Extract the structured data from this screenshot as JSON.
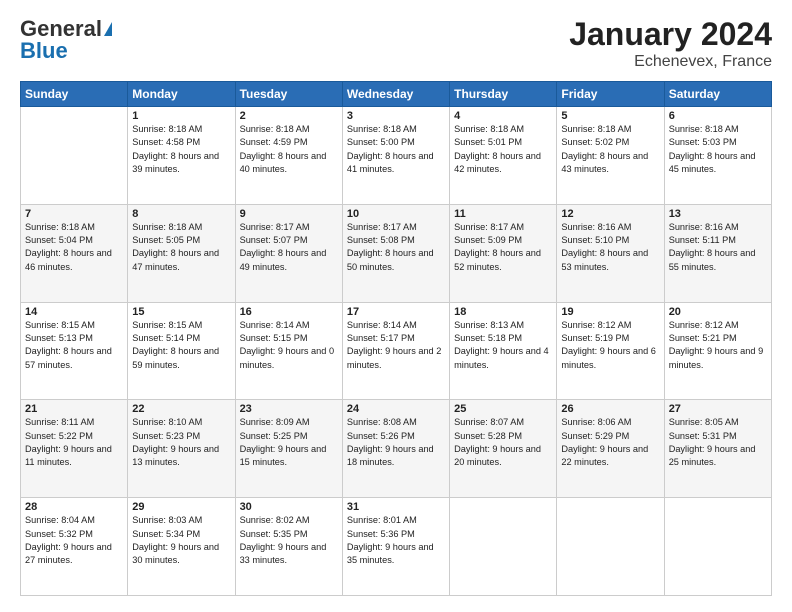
{
  "header": {
    "logo_line1": "General",
    "logo_line2": "Blue",
    "title": "January 2024",
    "subtitle": "Echenevex, France"
  },
  "weekdays": [
    "Sunday",
    "Monday",
    "Tuesday",
    "Wednesday",
    "Thursday",
    "Friday",
    "Saturday"
  ],
  "weeks": [
    [
      {
        "day": "",
        "sunrise": "",
        "sunset": "",
        "daylight": ""
      },
      {
        "day": "1",
        "sunrise": "Sunrise: 8:18 AM",
        "sunset": "Sunset: 4:58 PM",
        "daylight": "Daylight: 8 hours and 39 minutes."
      },
      {
        "day": "2",
        "sunrise": "Sunrise: 8:18 AM",
        "sunset": "Sunset: 4:59 PM",
        "daylight": "Daylight: 8 hours and 40 minutes."
      },
      {
        "day": "3",
        "sunrise": "Sunrise: 8:18 AM",
        "sunset": "Sunset: 5:00 PM",
        "daylight": "Daylight: 8 hours and 41 minutes."
      },
      {
        "day": "4",
        "sunrise": "Sunrise: 8:18 AM",
        "sunset": "Sunset: 5:01 PM",
        "daylight": "Daylight: 8 hours and 42 minutes."
      },
      {
        "day": "5",
        "sunrise": "Sunrise: 8:18 AM",
        "sunset": "Sunset: 5:02 PM",
        "daylight": "Daylight: 8 hours and 43 minutes."
      },
      {
        "day": "6",
        "sunrise": "Sunrise: 8:18 AM",
        "sunset": "Sunset: 5:03 PM",
        "daylight": "Daylight: 8 hours and 45 minutes."
      }
    ],
    [
      {
        "day": "7",
        "sunrise": "Sunrise: 8:18 AM",
        "sunset": "Sunset: 5:04 PM",
        "daylight": "Daylight: 8 hours and 46 minutes."
      },
      {
        "day": "8",
        "sunrise": "Sunrise: 8:18 AM",
        "sunset": "Sunset: 5:05 PM",
        "daylight": "Daylight: 8 hours and 47 minutes."
      },
      {
        "day": "9",
        "sunrise": "Sunrise: 8:17 AM",
        "sunset": "Sunset: 5:07 PM",
        "daylight": "Daylight: 8 hours and 49 minutes."
      },
      {
        "day": "10",
        "sunrise": "Sunrise: 8:17 AM",
        "sunset": "Sunset: 5:08 PM",
        "daylight": "Daylight: 8 hours and 50 minutes."
      },
      {
        "day": "11",
        "sunrise": "Sunrise: 8:17 AM",
        "sunset": "Sunset: 5:09 PM",
        "daylight": "Daylight: 8 hours and 52 minutes."
      },
      {
        "day": "12",
        "sunrise": "Sunrise: 8:16 AM",
        "sunset": "Sunset: 5:10 PM",
        "daylight": "Daylight: 8 hours and 53 minutes."
      },
      {
        "day": "13",
        "sunrise": "Sunrise: 8:16 AM",
        "sunset": "Sunset: 5:11 PM",
        "daylight": "Daylight: 8 hours and 55 minutes."
      }
    ],
    [
      {
        "day": "14",
        "sunrise": "Sunrise: 8:15 AM",
        "sunset": "Sunset: 5:13 PM",
        "daylight": "Daylight: 8 hours and 57 minutes."
      },
      {
        "day": "15",
        "sunrise": "Sunrise: 8:15 AM",
        "sunset": "Sunset: 5:14 PM",
        "daylight": "Daylight: 8 hours and 59 minutes."
      },
      {
        "day": "16",
        "sunrise": "Sunrise: 8:14 AM",
        "sunset": "Sunset: 5:15 PM",
        "daylight": "Daylight: 9 hours and 0 minutes."
      },
      {
        "day": "17",
        "sunrise": "Sunrise: 8:14 AM",
        "sunset": "Sunset: 5:17 PM",
        "daylight": "Daylight: 9 hours and 2 minutes."
      },
      {
        "day": "18",
        "sunrise": "Sunrise: 8:13 AM",
        "sunset": "Sunset: 5:18 PM",
        "daylight": "Daylight: 9 hours and 4 minutes."
      },
      {
        "day": "19",
        "sunrise": "Sunrise: 8:12 AM",
        "sunset": "Sunset: 5:19 PM",
        "daylight": "Daylight: 9 hours and 6 minutes."
      },
      {
        "day": "20",
        "sunrise": "Sunrise: 8:12 AM",
        "sunset": "Sunset: 5:21 PM",
        "daylight": "Daylight: 9 hours and 9 minutes."
      }
    ],
    [
      {
        "day": "21",
        "sunrise": "Sunrise: 8:11 AM",
        "sunset": "Sunset: 5:22 PM",
        "daylight": "Daylight: 9 hours and 11 minutes."
      },
      {
        "day": "22",
        "sunrise": "Sunrise: 8:10 AM",
        "sunset": "Sunset: 5:23 PM",
        "daylight": "Daylight: 9 hours and 13 minutes."
      },
      {
        "day": "23",
        "sunrise": "Sunrise: 8:09 AM",
        "sunset": "Sunset: 5:25 PM",
        "daylight": "Daylight: 9 hours and 15 minutes."
      },
      {
        "day": "24",
        "sunrise": "Sunrise: 8:08 AM",
        "sunset": "Sunset: 5:26 PM",
        "daylight": "Daylight: 9 hours and 18 minutes."
      },
      {
        "day": "25",
        "sunrise": "Sunrise: 8:07 AM",
        "sunset": "Sunset: 5:28 PM",
        "daylight": "Daylight: 9 hours and 20 minutes."
      },
      {
        "day": "26",
        "sunrise": "Sunrise: 8:06 AM",
        "sunset": "Sunset: 5:29 PM",
        "daylight": "Daylight: 9 hours and 22 minutes."
      },
      {
        "day": "27",
        "sunrise": "Sunrise: 8:05 AM",
        "sunset": "Sunset: 5:31 PM",
        "daylight": "Daylight: 9 hours and 25 minutes."
      }
    ],
    [
      {
        "day": "28",
        "sunrise": "Sunrise: 8:04 AM",
        "sunset": "Sunset: 5:32 PM",
        "daylight": "Daylight: 9 hours and 27 minutes."
      },
      {
        "day": "29",
        "sunrise": "Sunrise: 8:03 AM",
        "sunset": "Sunset: 5:34 PM",
        "daylight": "Daylight: 9 hours and 30 minutes."
      },
      {
        "day": "30",
        "sunrise": "Sunrise: 8:02 AM",
        "sunset": "Sunset: 5:35 PM",
        "daylight": "Daylight: 9 hours and 33 minutes."
      },
      {
        "day": "31",
        "sunrise": "Sunrise: 8:01 AM",
        "sunset": "Sunset: 5:36 PM",
        "daylight": "Daylight: 9 hours and 35 minutes."
      },
      {
        "day": "",
        "sunrise": "",
        "sunset": "",
        "daylight": ""
      },
      {
        "day": "",
        "sunrise": "",
        "sunset": "",
        "daylight": ""
      },
      {
        "day": "",
        "sunrise": "",
        "sunset": "",
        "daylight": ""
      }
    ]
  ]
}
